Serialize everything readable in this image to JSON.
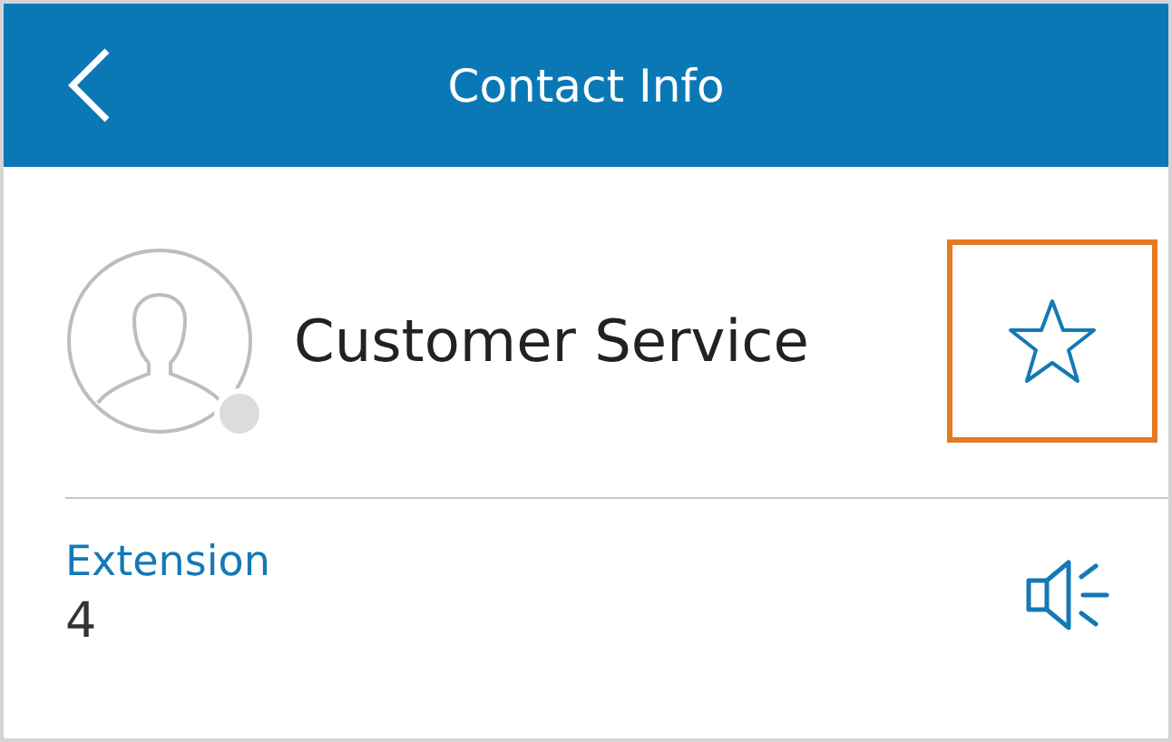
{
  "header": {
    "title": "Contact Info"
  },
  "contact": {
    "name": "Customer Service",
    "favorite": false
  },
  "fields": [
    {
      "label": "Extension",
      "value": "4"
    }
  ]
}
